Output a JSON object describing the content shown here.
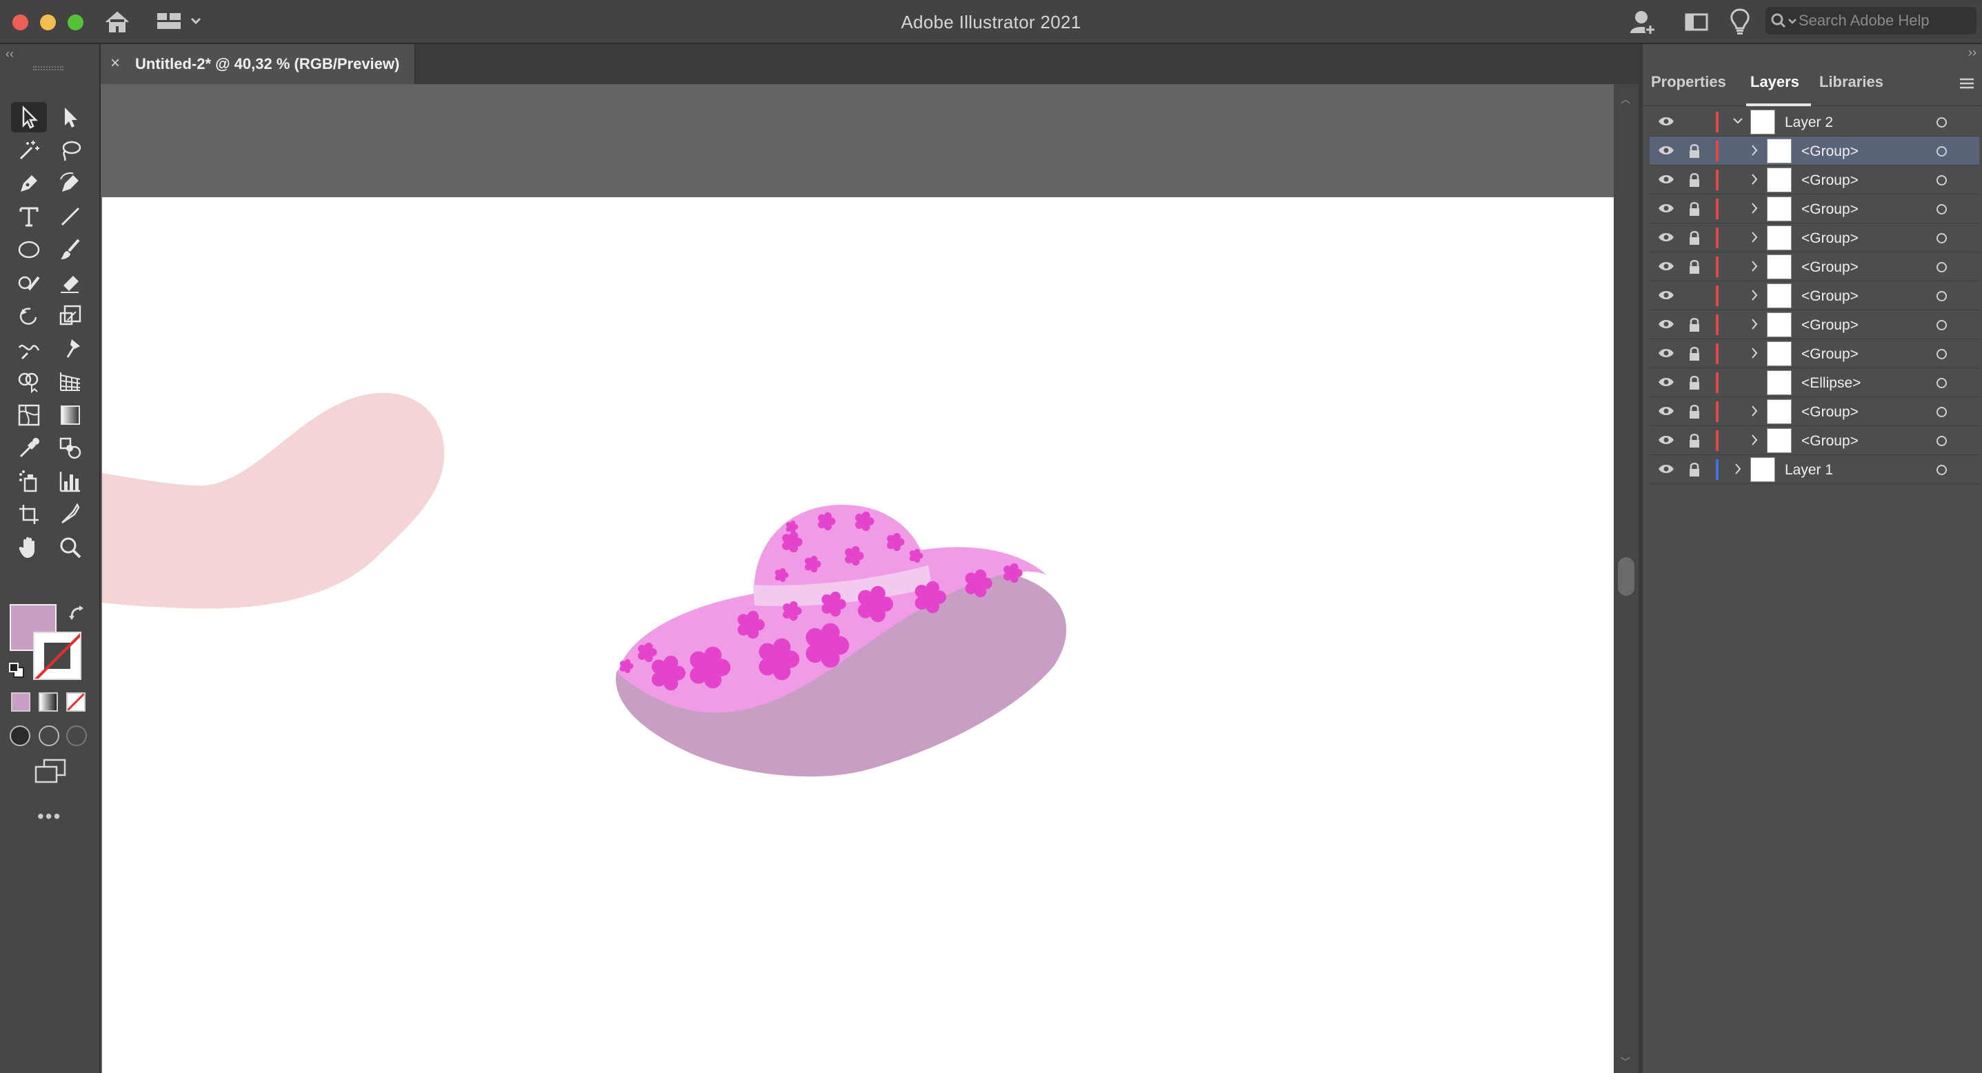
{
  "app": {
    "title": "Adobe Illustrator 2021"
  },
  "search": {
    "placeholder": "Search Adobe Help"
  },
  "document": {
    "tab_title": "Untitled-2* @ 40,32 % (RGB/Preview)",
    "close_glyph": "×"
  },
  "toolbar": {
    "tools": [
      {
        "name": "selection-tool",
        "active": true
      },
      {
        "name": "direct-selection-tool"
      },
      {
        "name": "magic-wand-tool"
      },
      {
        "name": "lasso-tool"
      },
      {
        "name": "pen-tool"
      },
      {
        "name": "curvature-tool"
      },
      {
        "name": "type-tool"
      },
      {
        "name": "line-segment-tool"
      },
      {
        "name": "ellipse-tool"
      },
      {
        "name": "paintbrush-tool"
      },
      {
        "name": "shaper-tool"
      },
      {
        "name": "eraser-tool"
      },
      {
        "name": "rotate-tool"
      },
      {
        "name": "scale-tool"
      },
      {
        "name": "warp-tool"
      },
      {
        "name": "puppet-warp-tool"
      },
      {
        "name": "shape-builder-tool"
      },
      {
        "name": "perspective-grid-tool"
      },
      {
        "name": "mesh-tool"
      },
      {
        "name": "gradient-tool"
      },
      {
        "name": "eyedropper-tool"
      },
      {
        "name": "blend-tool"
      },
      {
        "name": "symbol-sprayer-tool"
      },
      {
        "name": "column-graph-tool"
      },
      {
        "name": "artboard-tool"
      },
      {
        "name": "slice-tool"
      },
      {
        "name": "hand-tool"
      },
      {
        "name": "zoom-tool"
      }
    ],
    "fill_color": "#c89ec4",
    "stroke": "none",
    "more_label": "•••"
  },
  "panel": {
    "tabs": [
      "Properties",
      "Layers",
      "Libraries"
    ],
    "active_tab": "Layers",
    "layers": [
      {
        "name": "Layer 2",
        "level": 0,
        "expanded": true,
        "locked": false,
        "color": "#e0484a",
        "selected": false
      },
      {
        "name": "<Group>",
        "level": 1,
        "locked": true,
        "color": "#e0484a",
        "selected": true
      },
      {
        "name": "<Group>",
        "level": 1,
        "locked": true,
        "color": "#e0484a",
        "selected": false
      },
      {
        "name": "<Group>",
        "level": 1,
        "locked": true,
        "color": "#e0484a",
        "selected": false
      },
      {
        "name": "<Group>",
        "level": 1,
        "locked": true,
        "color": "#e0484a",
        "selected": false
      },
      {
        "name": "<Group>",
        "level": 1,
        "locked": true,
        "color": "#e0484a",
        "selected": false
      },
      {
        "name": "<Group>",
        "level": 1,
        "locked": false,
        "color": "#e0484a",
        "selected": false
      },
      {
        "name": "<Group>",
        "level": 1,
        "locked": true,
        "color": "#e0484a",
        "selected": false
      },
      {
        "name": "<Group>",
        "level": 1,
        "locked": true,
        "color": "#e0484a",
        "selected": false
      },
      {
        "name": "<Ellipse>",
        "level": 1,
        "locked": true,
        "color": "#e0484a",
        "selected": false,
        "no_children": true
      },
      {
        "name": "<Group>",
        "level": 1,
        "locked": true,
        "color": "#e0484a",
        "selected": false
      },
      {
        "name": "<Group>",
        "level": 1,
        "locked": true,
        "color": "#e0484a",
        "selected": false
      },
      {
        "name": "Layer 1",
        "level": 0,
        "expanded": false,
        "locked": true,
        "color": "#4a6ee0",
        "selected": false
      }
    ]
  },
  "artwork": {
    "brim_color": "#c89ec4",
    "crown_color": "#f09be6",
    "flower_color": "#e444cc",
    "band_color": "#f3c9ef",
    "shape_color": "#f4d4d4"
  }
}
